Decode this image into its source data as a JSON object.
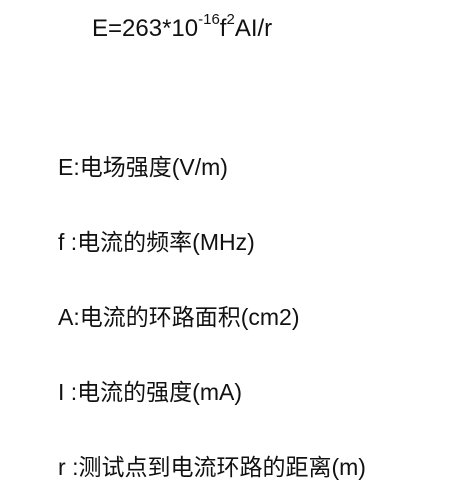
{
  "formula": {
    "base": "E=263*10",
    "exponent": "-16",
    "freq_symbol": "f",
    "freq_exponent": "2",
    "rest": "AI/r"
  },
  "definitions": [
    {
      "symbol": "E",
      "separator": ":",
      "text": "电场强度(V/m)"
    },
    {
      "symbol": "f ",
      "separator": ":",
      "text": "电流的频率(MHz)"
    },
    {
      "symbol": "A",
      "separator": ":",
      "text": "电流的环路面积(cm2)"
    },
    {
      "symbol": "I ",
      "separator": ":",
      "text": "电流的强度(mA)"
    },
    {
      "symbol": "r ",
      "separator": ":",
      "text": "测试点到电流环路的距离(m)"
    }
  ]
}
